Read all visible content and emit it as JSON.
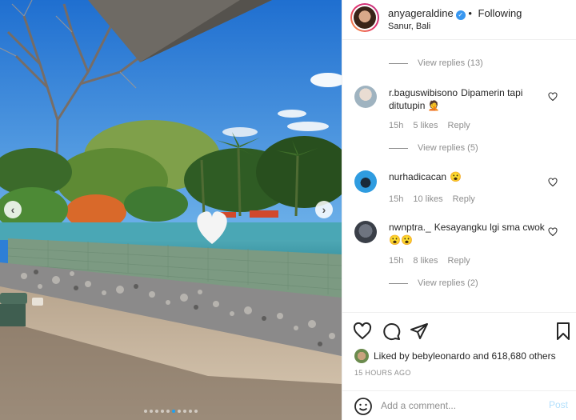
{
  "header": {
    "username": "anyageraldine",
    "separator": "•",
    "follow_status": "Following",
    "location": "Sanur, Bali"
  },
  "comments": {
    "view_replies_1": "View replies (13)",
    "items": [
      {
        "username": "r.baguswibisono",
        "text": "Dipamerin tapi ditutupin 🤦",
        "time": "15h",
        "likes": "5 likes",
        "reply": "Reply",
        "view_replies": "View replies (5)"
      },
      {
        "username": "nurhadicacan",
        "text": "😮",
        "time": "15h",
        "likes": "10 likes",
        "reply": "Reply",
        "view_replies": ""
      },
      {
        "username": "nwnptra._",
        "text": "Kesayangku lgi sma cwok😮😮",
        "time": "15h",
        "likes": "8 likes",
        "reply": "Reply",
        "view_replies": "View replies (2)"
      }
    ]
  },
  "likes": {
    "prefix": "Liked by",
    "user": "bebyleonardo",
    "connector": "and",
    "others": "618,680 others"
  },
  "time_ago": "15 HOURS AGO",
  "comment_box": {
    "placeholder": "Add a comment...",
    "post_label": "Post"
  },
  "carousel": {
    "slide_count": 10,
    "active_index": 5
  },
  "icons": {
    "prev": "chevron-left-icon",
    "next": "chevron-right-icon",
    "like": "heart-icon",
    "comment": "comment-icon",
    "share": "send-icon",
    "save": "bookmark-icon",
    "emoji": "smiley-icon"
  },
  "colors": {
    "verified": "#3897f0",
    "post_disabled": "#b2dffc",
    "muted_text": "#8e8e8e"
  }
}
